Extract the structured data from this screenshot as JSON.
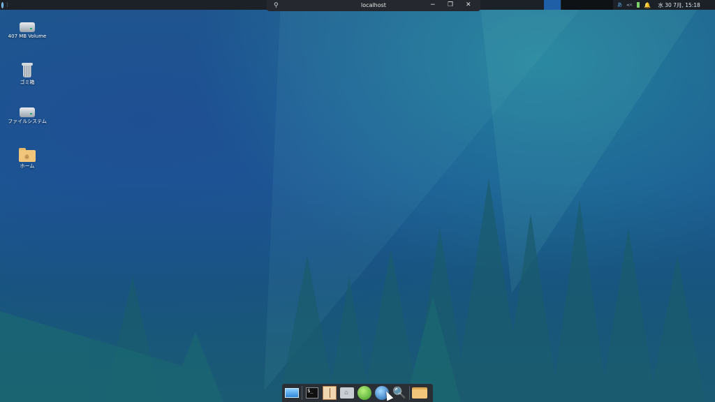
{
  "top_panel": {
    "window_title": "localhost",
    "minimize_icon": "−",
    "restore_icon": "❐",
    "close_icon": "✕",
    "pin_icon": "⚲",
    "tray": {
      "ime": "あ",
      "volume": "◂×",
      "notification_icon": "🔔",
      "clock": "水 30  7月, 15:18"
    }
  },
  "desktop_icons": [
    {
      "label": "407 MB Volume",
      "icon": "drive-icon"
    },
    {
      "label": "ゴミ箱",
      "icon": "trash-icon"
    },
    {
      "label": "ファイルシステム",
      "icon": "drive-icon"
    },
    {
      "label": "ホーム",
      "icon": "home-folder-icon"
    }
  ],
  "dock": {
    "items": [
      {
        "name": "show-desktop",
        "icon": "desktop-icon"
      },
      {
        "name": "terminal",
        "icon": "terminal-icon",
        "text": "$_"
      },
      {
        "name": "text-editor",
        "icon": "tree-icon"
      },
      {
        "name": "file-manager",
        "icon": "home-icon",
        "text": "⌂"
      },
      {
        "name": "app-leaf",
        "icon": "leaf-icon"
      },
      {
        "name": "web-browser",
        "icon": "globe-icon"
      },
      {
        "name": "app-finder",
        "icon": "search-icon",
        "text": "🔍"
      },
      {
        "name": "folder",
        "icon": "folder-icon"
      }
    ]
  },
  "colors": {
    "panel_bg": "#1c2128",
    "workspace_active": "#1f5fa8",
    "desktop_top": "#1f5a8c",
    "desktop_bottom": "#1a5a72"
  }
}
